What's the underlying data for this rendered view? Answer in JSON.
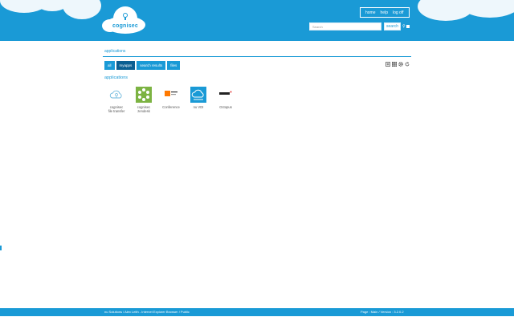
{
  "brand": {
    "logo_text": "cognisec",
    "accent": "#1a9ad6",
    "dark": "#0b5f92"
  },
  "topnav": {
    "items": [
      "home",
      "help",
      "log off"
    ]
  },
  "search": {
    "placeholder": "Search",
    "button_label": "search"
  },
  "section": {
    "title": "applications"
  },
  "filters": [
    {
      "label": "all",
      "active": false
    },
    {
      "label": "myapps",
      "active": true
    },
    {
      "label": "search results",
      "active": false
    },
    {
      "label": "files",
      "active": false
    }
  ],
  "view_tools": [
    "add-icon",
    "grid-icon",
    "gear-icon",
    "refresh-icon"
  ],
  "apps_heading": "applications",
  "apps": [
    {
      "line1": "cognisec",
      "line2": "file transfer",
      "icon": "cloud-share-icon"
    },
    {
      "line1": "cognisec",
      "line2": "zendesk",
      "icon": "zendesk-icon"
    },
    {
      "line1": "Conference",
      "line2": "",
      "icon": "orange-icon"
    },
    {
      "line1": "nu VDI",
      "line2": "",
      "icon": "vdi-cloud-icon"
    },
    {
      "line1": "Octopus",
      "line2": "",
      "icon": "octopus-icon"
    }
  ],
  "footer": {
    "left": "nu Solutions / Alex Leith - Internet Explorer Browser / Public",
    "right": "Page : Main / Version : 3.2.0.2"
  }
}
